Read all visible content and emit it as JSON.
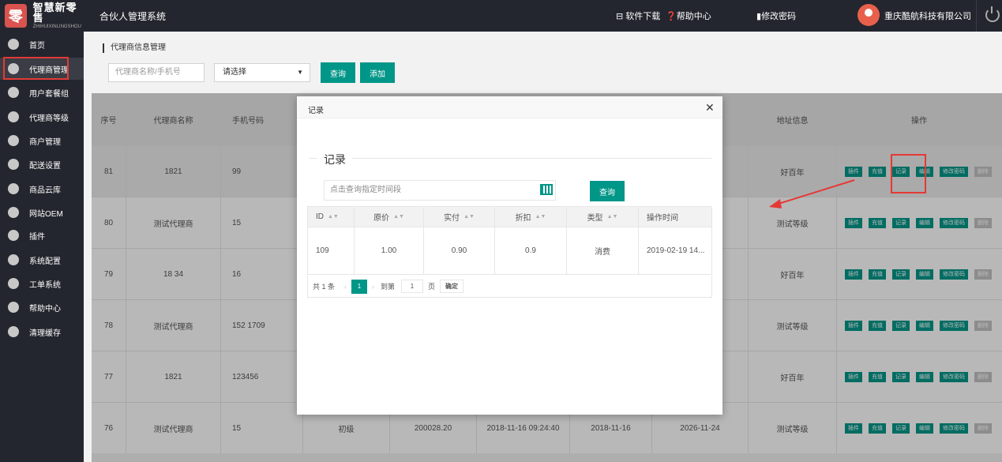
{
  "topbar": {
    "logo_cn": "智慧新零售",
    "logo_en": "ZHIHUIXINLINGSHOU",
    "logo_mark": "零",
    "system_title": "合伙人管理系统",
    "download": "软件下载",
    "help": "帮助中心",
    "change_password": "修改密码",
    "company": "重庆酷航科技有限公司"
  },
  "sidebar": {
    "items": [
      {
        "label": "首页",
        "icon": "home-icon"
      },
      {
        "label": "代理商管理",
        "icon": "agent-icon"
      },
      {
        "label": "用户套餐组",
        "icon": "package-icon"
      },
      {
        "label": "代理商等级",
        "icon": "level-icon"
      },
      {
        "label": "商户管理",
        "icon": "merchant-icon"
      },
      {
        "label": "配送设置",
        "icon": "delivery-icon"
      },
      {
        "label": "商品云库",
        "icon": "cloud-icon"
      },
      {
        "label": "网站OEM",
        "icon": "oem-icon"
      },
      {
        "label": "插件",
        "icon": "plugin-icon"
      },
      {
        "label": "系统配置",
        "icon": "config-icon"
      },
      {
        "label": "工单系统",
        "icon": "ticket-icon"
      },
      {
        "label": "帮助中心",
        "icon": "help-icon"
      },
      {
        "label": "清理缓存",
        "icon": "trash-icon"
      }
    ]
  },
  "main": {
    "breadcrumb": "代理商信息管理",
    "search_placeholder": "代理商名称/手机号",
    "select_value": "请选择",
    "query_label": "查询",
    "add_label": "添加"
  },
  "table": {
    "headers": {
      "no": "序号",
      "name": "代理商名称",
      "phone": "手机号码",
      "address": "地址信息",
      "ops": "操作"
    },
    "rows": [
      {
        "no": "81",
        "name": "1821",
        "phone": "99",
        "level": "",
        "balance": "",
        "time": "",
        "start": "",
        "end": "",
        "address": "好百年"
      },
      {
        "no": "80",
        "name": "测试代理商",
        "phone": "15",
        "level": "",
        "balance": "",
        "time": "",
        "start": "",
        "end": "",
        "address": "测试等级"
      },
      {
        "no": "79",
        "name": "18  34",
        "phone": "16",
        "level": "",
        "balance": "",
        "time": "",
        "start": "",
        "end": "",
        "address": "好百年"
      },
      {
        "no": "78",
        "name": "测试代理商",
        "phone": "152   1709",
        "level": "",
        "balance": "",
        "time": "",
        "start": "",
        "end": "",
        "address": "测试等级"
      },
      {
        "no": "77",
        "name": "1821",
        "phone": "123456",
        "level": "",
        "balance": "",
        "time": "",
        "start": "",
        "end": "",
        "address": "好百年"
      },
      {
        "no": "76",
        "name": "测试代理商",
        "phone": "15",
        "level": "初级",
        "balance": "200028.20",
        "time": "2018-11-16 09:24:40",
        "start": "2018-11-16",
        "end": "2026-11-24",
        "address": "测试等级"
      }
    ],
    "ops": [
      "插件",
      "充值",
      "记录",
      "编辑",
      "修改密码",
      "删除"
    ]
  },
  "modal": {
    "title": "记录",
    "section_title": "记录",
    "date_placeholder": "点击查询指定时间段",
    "query_label": "查询",
    "headers": [
      "ID",
      "原价",
      "实付",
      "折扣",
      "类型",
      "操作时间"
    ],
    "rows": [
      {
        "id": "109",
        "price": "1.00",
        "paid": "0.90",
        "discount": "0.9",
        "type": "消费",
        "time": "2019-02-19 14..."
      }
    ],
    "pager": {
      "total": "共 1 条",
      "current": "1",
      "goto": "到第",
      "page_input": "1",
      "page": "页",
      "confirm": "确定"
    }
  },
  "colors": {
    "accent": "#009688",
    "sidebar": "#23262e",
    "highlight": "#e53935"
  }
}
